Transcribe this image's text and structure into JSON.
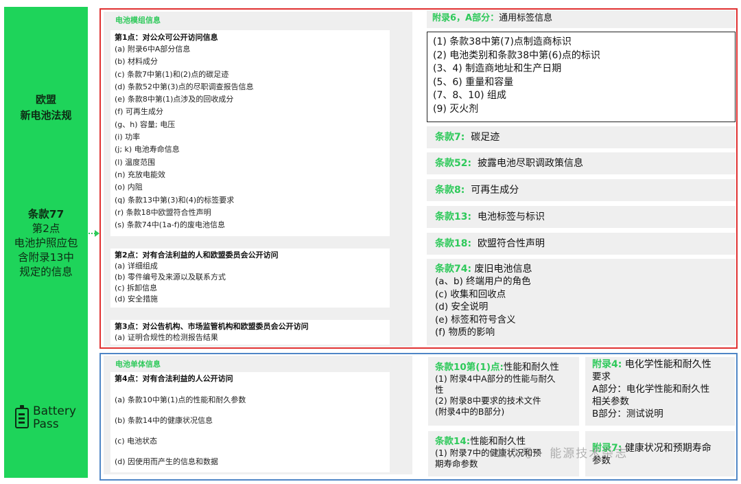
{
  "left": {
    "title_line1": "欧盟",
    "title_line2": "新电池法规",
    "main_line1": "条款77",
    "main_line2": "第2点",
    "main_line3": "电池护照应包",
    "main_line4": "含附录13中",
    "main_line5": "规定的信息",
    "logo_line1": "Battery",
    "logo_line2": "Pass"
  },
  "module": {
    "section_title": "电池模组信息",
    "point1": {
      "head": "第1点：对公众可公开访问信息",
      "items": [
        "(a) 附录6中A部分信息",
        "(b) 材料成分",
        "(c) 条款7中第(1)和(2)点的碳足迹",
        "(d) 条款52中第(3)点的尽职调查报告信息",
        "(e) 条款8中第(1)点涉及的回收成分",
        "(f) 可再生成分",
        "(g、h) 容量; 电压",
        "(i) 功率",
        "(j; k) 电池寿命信息",
        "(l) 温度范围",
        "(n) 充放电能效",
        "(o) 内阻",
        "(q) 条款13中第(3)和(4)的标签要求",
        "(r) 条款18中欧盟符合性声明",
        "(s) 条款74中(1a-f)的废电池信息"
      ]
    },
    "point2": {
      "head": "第2点：对有合法利益的人和欧盟委员会公开访问",
      "items": [
        "(a) 详细组成",
        "(b) 零件编号及来源以及联系方式",
        "(c) 拆卸信息",
        "(d) 安全措施"
      ]
    },
    "point3": {
      "head": "第3点：对公告机构、市场监管机构和欧盟委员会公开访问",
      "items": [
        "(a) 证明合规性的检测报告结果"
      ]
    }
  },
  "annex6": {
    "title_green": "附录6，A部分：",
    "title_rest": "通用标签信息",
    "items": [
      "(1) 条款38中第(7)点制造商标识",
      "(2) 电池类别和条款38中第(6)点的标识",
      "(3、4) 制造商地址和生产日期",
      "(5、6) 重量和容量",
      "(7、8、10) 组成",
      "(9) 灭火剂"
    ]
  },
  "articles": [
    {
      "key": "条款7:",
      "text": "碳足迹"
    },
    {
      "key": "条款52:",
      "text": "披露电池尽职调政策信息"
    },
    {
      "key": "条款8:",
      "text": "可再生成分"
    },
    {
      "key": "条款13:",
      "text": "电池标签与标识"
    },
    {
      "key": "条款18:",
      "text": "欧盟符合性声明"
    }
  ],
  "article74": {
    "key": "条款74:",
    "text": "废旧电池信息",
    "items": [
      "(a、b) 终端用户的角色",
      "(c) 收集和回收点",
      "(d) 安全说明",
      "(e) 标签和符号含义",
      "(f) 物质的影响"
    ]
  },
  "cell": {
    "section_title": "电池单体信息",
    "point4": {
      "head": "第4点：对有合法利益的人公开访问",
      "items": [
        "(a) 条款10中第(1)点的性能和耐久参数",
        "(b) 条款14中的健康状况信息",
        "(c) 电池状态",
        "(d) 因使用而产生的信息和数据"
      ]
    }
  },
  "art10": {
    "key": "条款10第(1)点:",
    "text": "性能和耐久性",
    "lines": [
      "(1) 附录4中A部分的性能与耐久",
      "性",
      "(2) 附录8中要求的技术文件",
      "(附录4中的B部分)"
    ]
  },
  "annex4": {
    "key": "附录4:",
    "text": "电化学性能和耐久性",
    "lines": [
      "要求",
      "A部分：电化学性能和耐久性",
      "相关参数",
      "B部分：测试说明"
    ]
  },
  "art14": {
    "key": "条款14:",
    "text": "性能和耐久性",
    "lines": [
      "(1) 附录7中的健康状况和预",
      "期寿命参数"
    ]
  },
  "annex7": {
    "key": "附录7:",
    "text": "健康状况和预期寿命",
    "lines": [
      "参数"
    ]
  },
  "watermark": "公众号 · 能源技术杂志",
  "colors": {
    "green": "#1ed45a",
    "accent_green": "#2ec95a",
    "red": "#e03030",
    "blue": "#4f86c6",
    "panel": "#efefef"
  }
}
